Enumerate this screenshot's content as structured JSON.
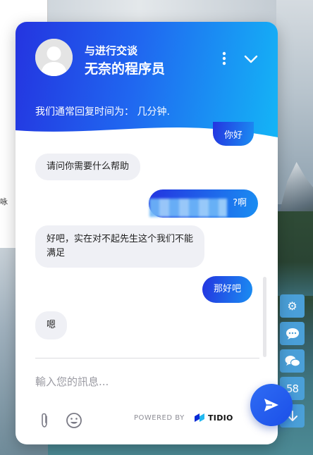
{
  "background": {
    "left_text": "咏"
  },
  "side_tools": {
    "count": "58"
  },
  "chat": {
    "header": {
      "subtitle": "与进行交谈",
      "title": "无奈的程序员",
      "reply_time": "我们通常回复时间为： 几分钟."
    },
    "messages": [
      {
        "from": "user",
        "text": "你好"
      },
      {
        "from": "bot",
        "text": "请问你需要什么帮助"
      },
      {
        "from": "user",
        "text": "?啊"
      },
      {
        "from": "bot",
        "text": "好吧，实在对不起先生这个我们不能"
      },
      {
        "from": "bot",
        "text": "满足"
      },
      {
        "from": "user",
        "text": "那好吧"
      },
      {
        "from": "bot",
        "text": "嗯"
      }
    ],
    "input": {
      "placeholder": "輸入您的訊息..."
    },
    "footer": {
      "powered_by": "POWERED BY",
      "brand": "TIDIO"
    }
  },
  "colors": {
    "accent_start": "#2434e0",
    "accent_end": "#14b6f6",
    "bot_bubble": "#eff0f5",
    "tool_button": "#4a9fd8"
  },
  "icons": [
    "gear-icon",
    "chat-bubble-icon",
    "chat-bubbles-icon",
    "arrow-down-icon",
    "menu-dots-icon",
    "chevron-down-icon",
    "paperclip-icon",
    "emoji-icon",
    "send-icon",
    "tidio-logo"
  ]
}
